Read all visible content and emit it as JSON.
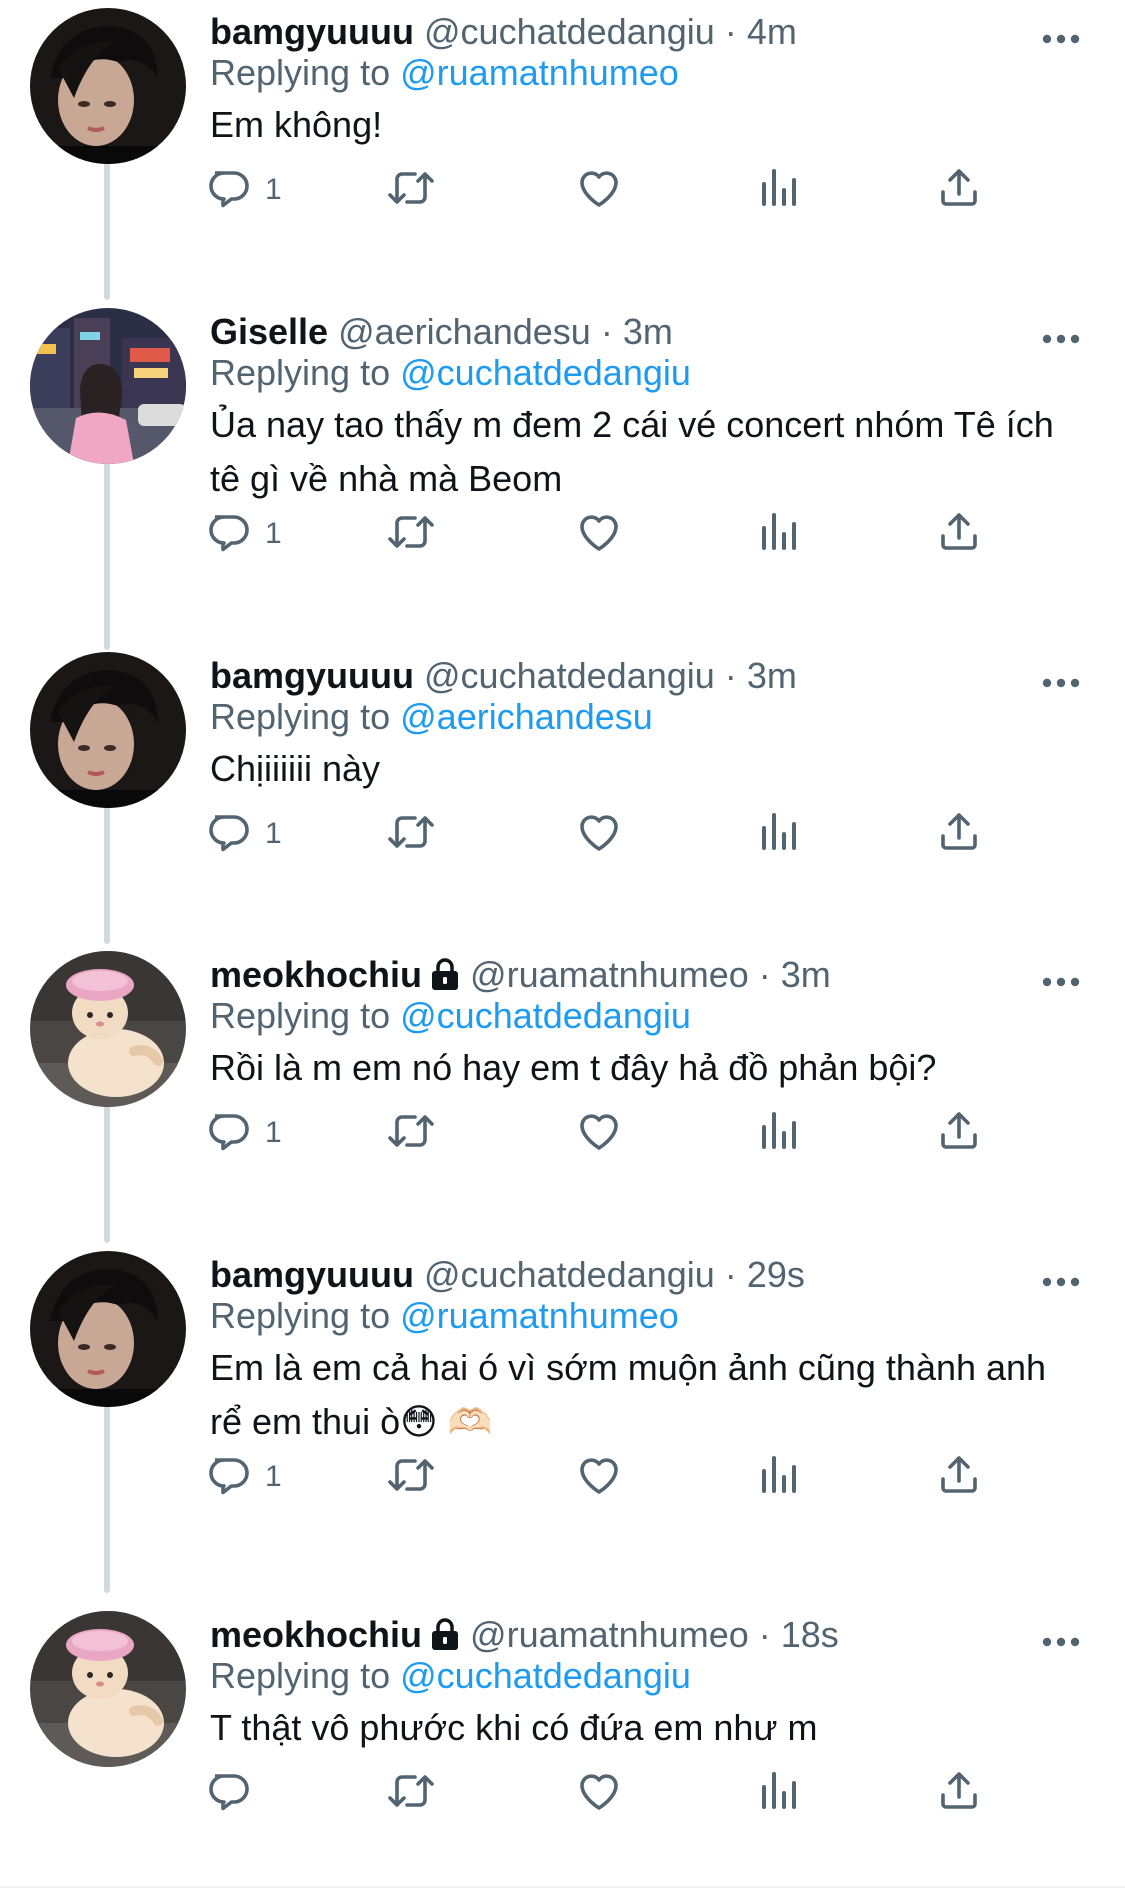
{
  "tweets": [
    {
      "name": "bamgyuuuu",
      "handle": "@cuchatdedangiu",
      "dot": "·",
      "time": "4m",
      "replying_label": "Replying to",
      "replying_to": "@ruamatnhumeo",
      "text": "Em không!",
      "reply_count": "1",
      "avatar": "photo-dark-hair",
      "locked": false
    },
    {
      "name": "Giselle",
      "handle": "@aerichandesu",
      "dot": "·",
      "time": "3m",
      "replying_label": "Replying to",
      "replying_to": "@cuchatdedangiu",
      "text": "Ủa nay tao thấy m đem 2 cái vé concert nhóm Tê ích tê gì về nhà mà Beom",
      "reply_count": "1",
      "avatar": "photo-city-night",
      "locked": false
    },
    {
      "name": "bamgyuuuu",
      "handle": "@cuchatdedangiu",
      "dot": "·",
      "time": "3m",
      "replying_label": "Replying to",
      "replying_to": "@aerichandesu",
      "text": "Chịiiiiii này",
      "reply_count": "1",
      "avatar": "photo-dark-hair",
      "locked": false
    },
    {
      "name": "meokhochiu",
      "handle": "@ruamatnhumeo",
      "dot": "·",
      "time": "3m",
      "replying_label": "Replying to",
      "replying_to": "@cuchatdedangiu",
      "text": "Rồi là m em nó hay em t đây hả đồ phản bội?",
      "reply_count": "1",
      "avatar": "photo-cat-shower-cap",
      "locked": true
    },
    {
      "name": "bamgyuuuu",
      "handle": "@cuchatdedangiu",
      "dot": "·",
      "time": "29s",
      "replying_label": "Replying to",
      "replying_to": "@ruamatnhumeo",
      "text": "Em là em cả hai ó vì sớm muộn ảnh cũng thành anh rể em thui ò😳 🫶🏻",
      "reply_count": "1",
      "avatar": "photo-dark-hair",
      "locked": false
    },
    {
      "name": "meokhochiu",
      "handle": "@ruamatnhumeo",
      "dot": "·",
      "time": "18s",
      "replying_label": "Replying to",
      "replying_to": "@cuchatdedangiu",
      "text": "T thật vô phước khi có đứa em như m",
      "reply_count": "",
      "avatar": "photo-cat-shower-cap",
      "locked": true
    }
  ],
  "icons": {
    "reply": "reply-icon",
    "retweet": "retweet-icon",
    "like": "like-icon",
    "views": "views-icon",
    "share": "share-icon",
    "more": "more-icon",
    "lock": "lock-icon"
  },
  "colors": {
    "text": "#0f1419",
    "secondary": "#536471",
    "mention": "#1d9bf0",
    "thread_line": "#cfd9de"
  }
}
